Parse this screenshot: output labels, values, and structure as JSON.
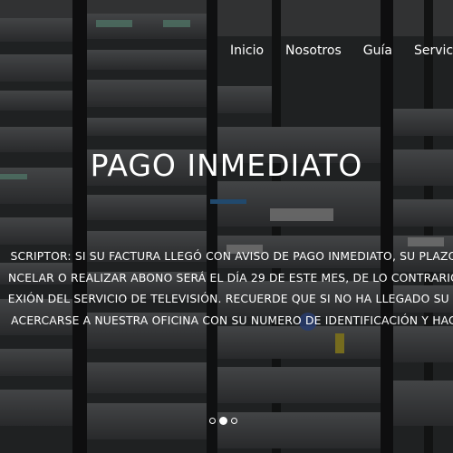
{
  "nav": {
    "items": [
      "Inicio",
      "Nosotros",
      "Guía",
      "Servicios"
    ]
  },
  "hero": {
    "title": "PAGO INMEDIATO",
    "notice_lines": [
      "SCRIPTOR: SI SU FACTURA LLEGÓ CON AVISO DE PAGO INMEDIATO, SU PLAZO",
      "NCELAR O REALIZAR ABONO SERÁ EL DÍA 29 DE ESTE MES, DE LO CONTRARIO",
      "EXIÓN DEL SERVICIO DE TELEVISIÓN. RECUERDE QUE SI NO HA LLEGADO SU F",
      "ACERCARSE A NUESTRA OFICINA CON SU NUMERO DE IDENTIFICACIÓN Y HAC"
    ]
  },
  "carousel": {
    "slide_count": 3,
    "active_index": 1
  },
  "colors": {
    "text": "#ffffff",
    "overlay": "#000000"
  }
}
